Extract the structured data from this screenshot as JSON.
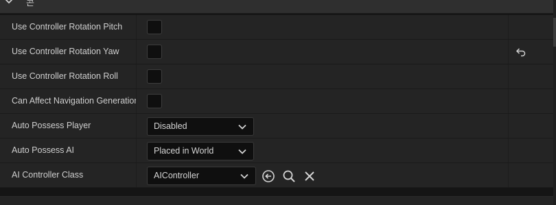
{
  "section": {
    "title": "콘"
  },
  "properties": [
    {
      "label": "Use Controller Rotation Pitch",
      "type": "checkbox",
      "checked": false
    },
    {
      "label": "Use Controller Rotation Yaw",
      "type": "checkbox",
      "checked": false,
      "reset_icon": "undo-arrow-icon"
    },
    {
      "label": "Use Controller Rotation Roll",
      "type": "checkbox",
      "checked": false
    },
    {
      "label": "Can Affect Navigation Generation",
      "type": "checkbox",
      "checked": false
    },
    {
      "label": "Auto Possess Player",
      "type": "dropdown",
      "value": "Disabled"
    },
    {
      "label": "Auto Possess AI",
      "type": "dropdown",
      "value": "Placed in World"
    },
    {
      "label": "AI Controller Class",
      "type": "class-picker",
      "value": "AIController",
      "actions": [
        "use-selected-icon",
        "browse-search-icon",
        "clear-icon"
      ]
    }
  ],
  "colors": {
    "background": "#242424",
    "field": "#0f0f0f",
    "text": "#cfcfcf"
  }
}
